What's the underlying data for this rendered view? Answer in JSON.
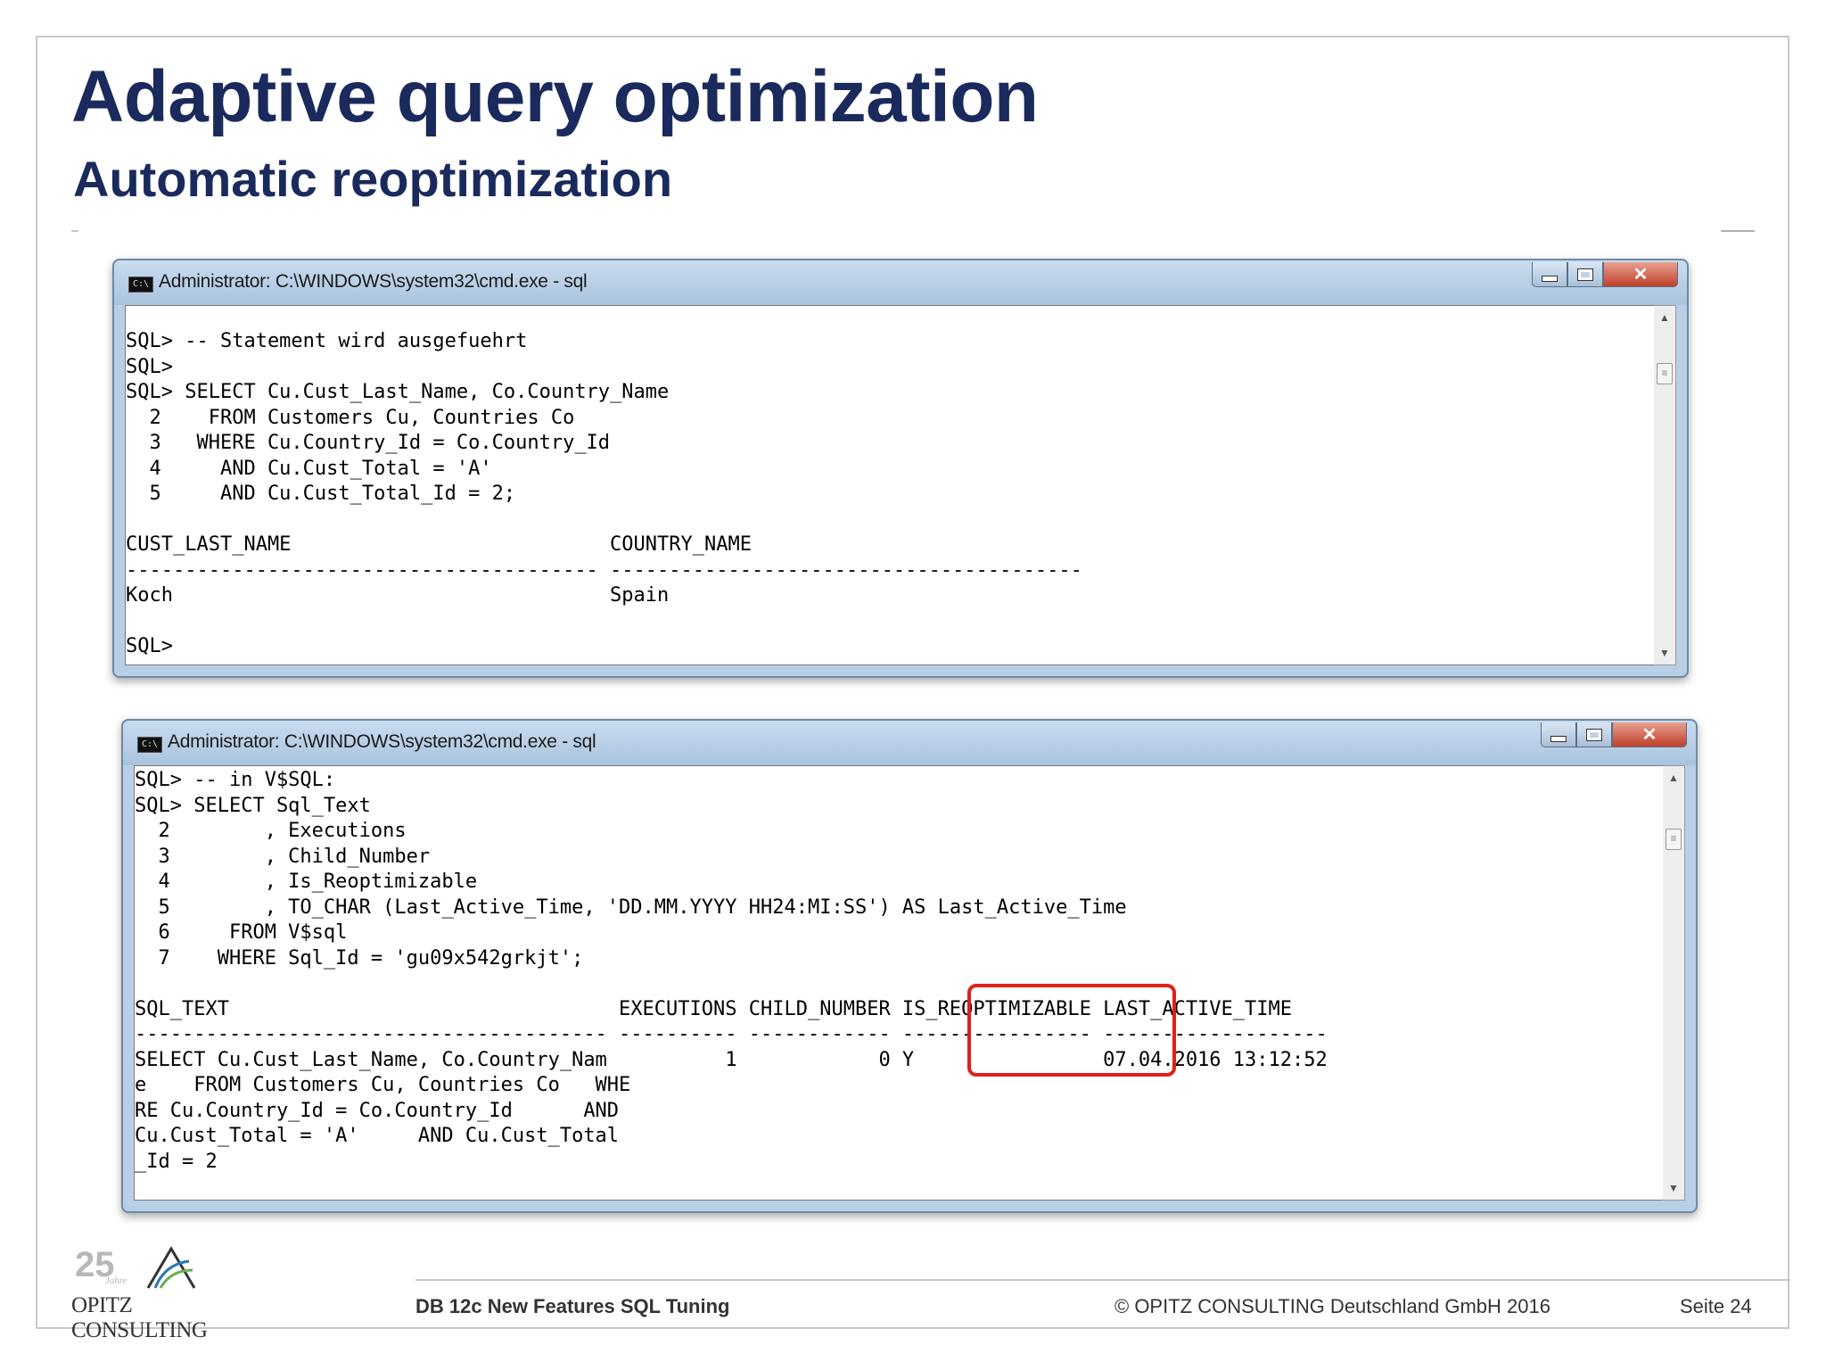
{
  "slide": {
    "title": "Adaptive query optimization",
    "subtitle": "Automatic reoptimization"
  },
  "window1": {
    "title": "Administrator: C:\\WINDOWS\\system32\\cmd.exe - sql",
    "icon": "cmd-icon",
    "console_text": "SQL> -- Statement wird ausgefuehrt\nSQL>\nSQL> SELECT Cu.Cust_Last_Name, Co.Country_Name\n  2    FROM Customers Cu, Countries Co\n  3   WHERE Cu.Country_Id = Co.Country_Id\n  4     AND Cu.Cust_Total = 'A'\n  5     AND Cu.Cust_Total_Id = 2;\n\nCUST_LAST_NAME                           COUNTRY_NAME\n---------------------------------------- ----------------------------------------\nKoch                                     Spain\n\nSQL>"
  },
  "window2": {
    "title": "Administrator: C:\\WINDOWS\\system32\\cmd.exe - sql",
    "icon": "cmd-icon",
    "console_text": "SQL> -- in V$SQL:\nSQL> SELECT Sql_Text\n  2        , Executions\n  3        , Child_Number\n  4        , Is_Reoptimizable\n  5        , TO_CHAR (Last_Active_Time, 'DD.MM.YYYY HH24:MI:SS') AS Last_Active_Time\n  6     FROM V$sql\n  7    WHERE Sql_Id = 'gu09x542grkjt';\n\nSQL_TEXT                                 EXECUTIONS CHILD_NUMBER IS_REOPTIMIZABLE LAST_ACTIVE_TIME\n---------------------------------------- ---------- ------------ ---------------- -------------------\nSELECT Cu.Cust_Last_Name, Co.Country_Nam          1            0 Y                07.04.2016 13:12:52\ne    FROM Customers Cu, Countries Co   WHE\nRE Cu.Country_Id = Co.Country_Id      AND\nCu.Cust_Total = 'A'     AND Cu.Cust_Total\n_Id = 2",
    "highlight_color": "#e0201b"
  },
  "footer": {
    "logo_number": "25",
    "logo_tag": "Jahre",
    "logo_name": "OPITZ CONSULTING",
    "left": "DB 12c New Features SQL Tuning",
    "copyright": "© OPITZ CONSULTING Deutschland GmbH 2016",
    "page": "Seite 24"
  },
  "colors": {
    "title": "#1b2a5c",
    "close_button": "#c0402a",
    "window_frame": "#b8cfe6"
  }
}
